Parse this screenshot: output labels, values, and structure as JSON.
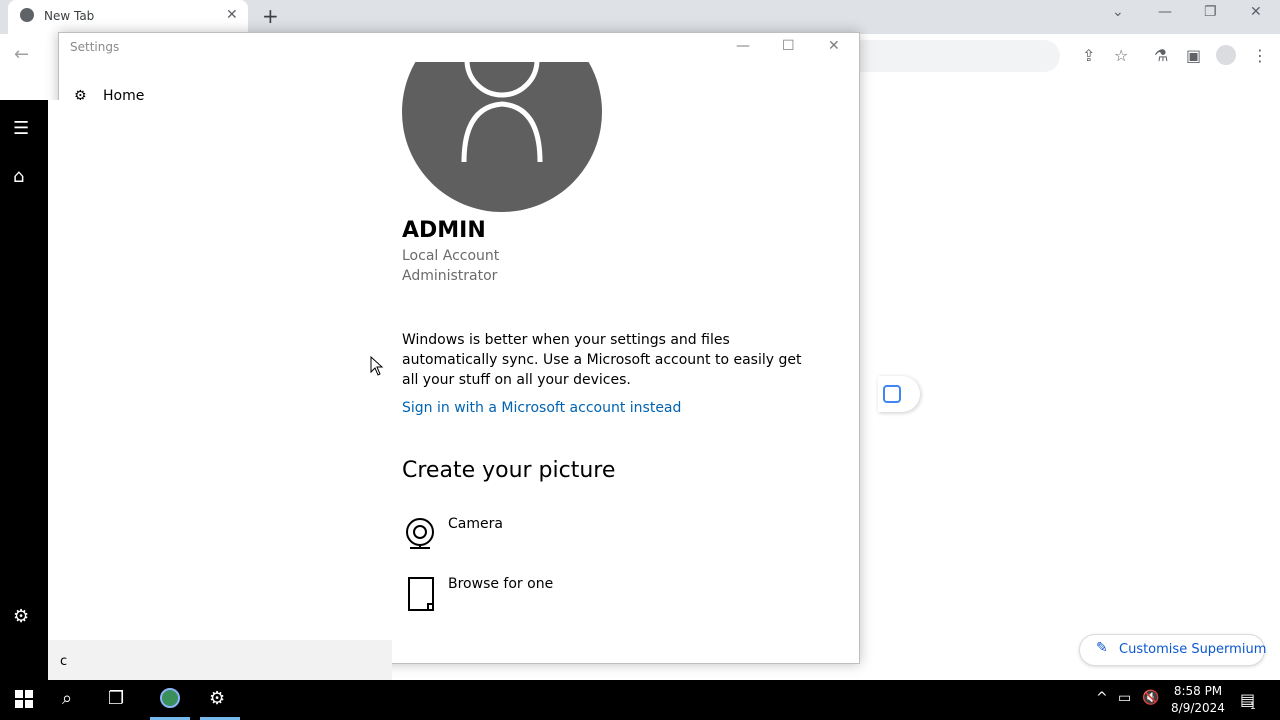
{
  "browser": {
    "tab_title": "New Tab",
    "customise_label": "Customise Supermium"
  },
  "settings": {
    "window_title": "Settings",
    "nav_home": "Home",
    "account": {
      "name": "ADMIN",
      "type": "Local Account",
      "role": "Administrator"
    },
    "sync_text": "Windows is better when your settings and files automatically sync. Use a Microsoft account to easily get all your stuff on all your devices.",
    "sign_in_link": "Sign in with a Microsoft account instead",
    "create_picture_heading": "Create your picture",
    "options": [
      {
        "label": "Camera",
        "icon": "camera-icon"
      },
      {
        "label": "Browse for one",
        "icon": "file-icon"
      }
    ],
    "search_value": "c"
  },
  "taskbar": {
    "time": "8:58 PM",
    "date": "8/9/2024",
    "notification_count": "1"
  }
}
